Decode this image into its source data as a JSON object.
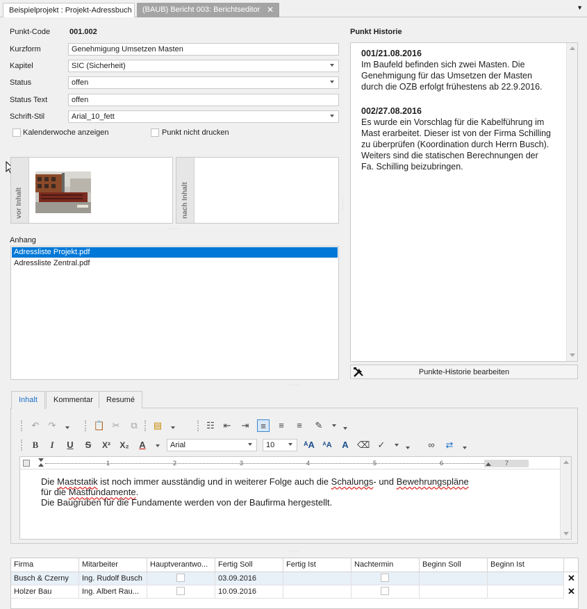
{
  "tabs": [
    {
      "label": "Beispielprojekt : Projekt-Adressbuch",
      "active": true
    },
    {
      "label": "(BAUB) Bericht 003: Berichtseditor",
      "active": false
    }
  ],
  "form": {
    "punkt_code_label": "Punkt-Code",
    "punkt_code_value": "001.002",
    "kurzform_label": "Kurzform",
    "kurzform_value": "Genehmigung Umsetzen Masten",
    "kapitel_label": "Kapitel",
    "kapitel_value": "SIC (Sicherheit)",
    "status_label": "Status",
    "status_value": "offen",
    "status_text_label": "Status Text",
    "status_text_value": "offen",
    "schrift_stil_label": "Schrift-Stil",
    "schrift_stil_value": "Arial_10_fett",
    "kalenderwoche_label": "Kalenderwoche anzeigen",
    "kalenderwoche_checked": false,
    "nicht_drucken_label": "Punkt nicht drucken",
    "nicht_drucken_checked": false
  },
  "images": {
    "vor_label": "vor Inhalt",
    "nach_label": "nach Inhalt"
  },
  "anhang": {
    "label": "Anhang",
    "items": [
      {
        "name": "Adressliste Projekt.pdf",
        "selected": true
      },
      {
        "name": "Adressliste Zentral.pdf",
        "selected": false
      }
    ]
  },
  "historie": {
    "title": "Punkt Historie",
    "entries": [
      {
        "head": "001/21.08.2016",
        "lines": [
          "Im Baufeld befinden sich zwei Masten. Die",
          "Genehmigung für das Umsetzen der Masten",
          "durch die OZB erfolgt frühestens ab 22.9.2016."
        ]
      },
      {
        "head": "002/27.08.2016",
        "lines": [
          "Es wurde ein Vorschlag für die Kabelführung im",
          "Mast erarbeitet. Dieser ist von der Firma Schilling",
          "zu überprüfen (Koordination durch Herrn Busch).",
          "Weiters sind die statischen Berechnungen der",
          "Fa. Schilling beizubringen."
        ]
      }
    ],
    "edit_button": "Punkte-Historie bearbeiten"
  },
  "subtabs": [
    "Inhalt",
    "Kommentar",
    "Resumé"
  ],
  "toolbar": {
    "font_name": "Arial",
    "font_size": "10",
    "bold": "B",
    "italic": "I",
    "underline": "U",
    "strike": "S",
    "superscript": "X²",
    "subscript": "X₂",
    "font_color": "A",
    "grow_font": "ᴬA",
    "shrink_font": "ᴬA",
    "case": "A"
  },
  "ruler": {
    "numbers": [
      "1",
      "2",
      "3",
      "4",
      "5",
      "6",
      "7"
    ]
  },
  "editor": {
    "line1_a": "Die ",
    "line1_w1": "Maststatik",
    "line1_b": " ist noch immer ausständig und in weiterer Folge auch die ",
    "line1_w2": "Schalungs",
    "line1_c": "- und ",
    "line1_w3": "Bewehrungspläne",
    "line2_a": "für die ",
    "line2_w1": "Mastfundamente",
    "line2_b": ".",
    "line3": "Die Baugruben für die Fundamente werden von der Baufirma hergestellt."
  },
  "grid": {
    "columns": [
      "Firma",
      "Mitarbeiter",
      "Hauptverantwo...",
      "Fertig Soll",
      "Fertig Ist",
      "Nachtermin",
      "Beginn Soll",
      "Beginn Ist"
    ],
    "rows": [
      {
        "firma": "Busch & Czerny",
        "mitarbeiter": "Ing. Rudolf Busch",
        "haupt": false,
        "fertig_soll": "03.09.2016",
        "fertig_ist": "",
        "nachtermin": false,
        "beginn_soll": "",
        "beginn_ist": ""
      },
      {
        "firma": "Holzer Bau",
        "mitarbeiter": "Ing. Albert Rau...",
        "haupt": false,
        "fertig_soll": "10.09.2016",
        "fertig_ist": "",
        "nachtermin": false,
        "beginn_soll": "",
        "beginn_ist": ""
      }
    ]
  },
  "icons": {
    "close": "close-icon",
    "tools": "tools-icon",
    "delete": "delete-row-icon"
  }
}
